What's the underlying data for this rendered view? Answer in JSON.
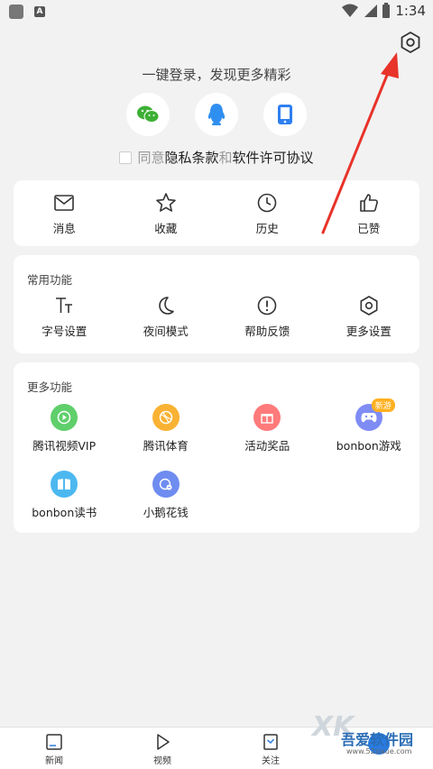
{
  "status_bar": {
    "time": "1:34",
    "left_badge": "A"
  },
  "login": {
    "title": "一键登录，发现更多精彩",
    "methods": [
      "wechat-icon",
      "qq-icon",
      "phone-icon"
    ],
    "agree_prefix": "同意",
    "privacy_link": "隐私条款",
    "and": "和",
    "license_link": "软件许可协议"
  },
  "quick_row": {
    "items": [
      {
        "label": "消息",
        "icon": "mail-icon"
      },
      {
        "label": "收藏",
        "icon": "star-icon"
      },
      {
        "label": "历史",
        "icon": "clock-icon"
      },
      {
        "label": "已赞",
        "icon": "thumbs-up-icon"
      }
    ]
  },
  "common": {
    "title": "常用功能",
    "items": [
      {
        "label": "字号设置",
        "icon": "font-size-icon"
      },
      {
        "label": "夜间模式",
        "icon": "moon-icon"
      },
      {
        "label": "帮助反馈",
        "icon": "exclamation-icon"
      },
      {
        "label": "更多设置",
        "icon": "gear-icon"
      }
    ]
  },
  "more": {
    "title": "更多功能",
    "items": [
      {
        "label": "腾讯视频VIP",
        "icon": "play-icon",
        "color": "#5fcf6b"
      },
      {
        "label": "腾讯体育",
        "icon": "ball-icon",
        "color": "#f9b233"
      },
      {
        "label": "活动奖品",
        "icon": "gift-icon",
        "color": "#ff7a7a"
      },
      {
        "label": "bonbon游戏",
        "icon": "gamepad-icon",
        "color": "#7f8cf4",
        "badge": "新游"
      },
      {
        "label": "bonbon读书",
        "icon": "book-icon",
        "color": "#4db8f0"
      },
      {
        "label": "小鹅花钱",
        "icon": "money-icon",
        "color": "#6f8cf0"
      }
    ]
  },
  "bottom_nav": {
    "items": [
      {
        "label": "新闻",
        "icon": "news-icon"
      },
      {
        "label": "视频",
        "icon": "video-icon"
      },
      {
        "label": "关注",
        "icon": "follow-icon"
      },
      {
        "label": "",
        "icon": "me-icon"
      }
    ]
  },
  "watermark": {
    "title": "吾爱软件园",
    "sub": "www.52zixue.com"
  },
  "colors": {
    "arrow": "#e8332a",
    "card_bg": "#ffffff",
    "page_bg": "#f2f2f2"
  }
}
